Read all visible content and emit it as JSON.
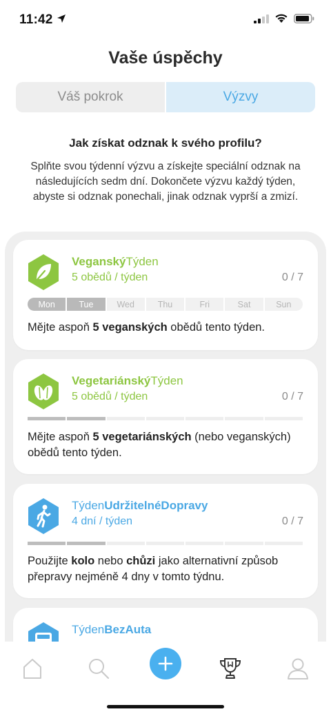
{
  "status": {
    "time": "11:42"
  },
  "title": "Vaše úspěchy",
  "tabs": {
    "progress": "Váš pokrok",
    "challenges": "Výzvy"
  },
  "intro": {
    "heading": "Jak získat odznak k svého profilu?",
    "text": "Splňte svou týdenní výzvu a získejte speciální odznak na následujících sedm dní. Dokončete výzvu každý týden, abyste si odznak ponechali, jinak odznak vyprší a zmizí."
  },
  "challenges": [
    {
      "title_bold": "Veganský",
      "title_rest": "Týden",
      "subtitle": "5 obědů / týden",
      "progress": "0 / 7",
      "days": [
        "Mon",
        "Tue",
        "Wed",
        "Thu",
        "Fri",
        "Sat",
        "Sun"
      ],
      "days_done": 2,
      "desc_a": "Mějte aspoň ",
      "desc_b": "5 veganských",
      "desc_c": " obědů tento týden.",
      "color": "#8dc641",
      "icon": "leaf-icon"
    },
    {
      "title_bold": "Vegetariánský",
      "title_rest": "Týden",
      "subtitle": "5 obědů / týden",
      "progress": "0 / 7",
      "days_done": 2,
      "desc_a": "Mějte aspoň ",
      "desc_b": "5 vegetariánských",
      "desc_c": " (nebo veganských) obědů tento týden.",
      "color": "#8dc641",
      "icon": "vegetable-icon"
    },
    {
      "title_rest_first": "Týden",
      "title_bold": "UdržitelnéDopravy",
      "subtitle": "4 dní / týden",
      "progress": "0 / 7",
      "days_done": 2,
      "desc_a": "Použijte ",
      "desc_b": "kolo",
      "desc_c": " nebo ",
      "desc_d": "chůzi",
      "desc_e": " jako alternativní způsob přepravy nejméně 4 dny v tomto týdnu.",
      "color": "#4aa8e4",
      "icon": "walking-person-icon"
    },
    {
      "title_rest_first": "Týden",
      "title_bold": "BezAuta",
      "color": "#4aa8e4",
      "icon": "car-icon"
    }
  ],
  "nav": [
    "home-icon",
    "search-icon",
    "add-icon",
    "trophy-icon",
    "profile-icon"
  ]
}
